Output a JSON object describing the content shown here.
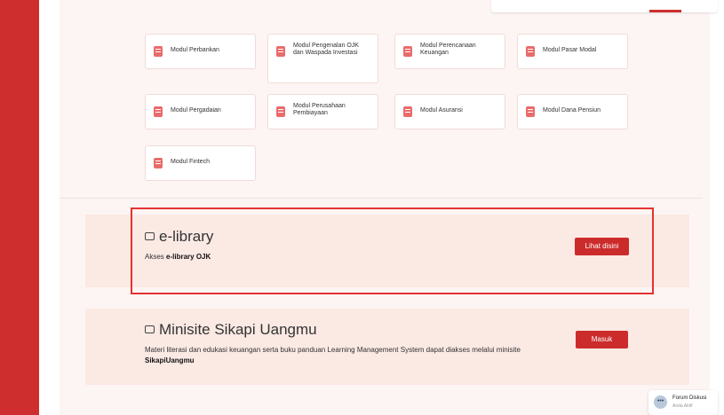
{
  "modules": [
    {
      "label": "Modul Perbankan"
    },
    {
      "label": "Modul Pengenalan OJK dan Waspada Investasi"
    },
    {
      "label": "Modul Perencanaan Keuangan"
    },
    {
      "label": "Modul Pasar Modal"
    },
    {
      "label": "Modul Pergadaian"
    },
    {
      "label": "Modul Perusahaan Pembiayaan"
    },
    {
      "label": "Modul Asuransi"
    },
    {
      "label": "Modul Dana Pensiun"
    },
    {
      "label": "Modul Fintech"
    }
  ],
  "elibrary": {
    "title": "e-library",
    "desc_prefix": "Akses",
    "desc_bold": "e-library OJK",
    "button": "Lihat disini"
  },
  "minisite": {
    "title": "Minisite Sikapi Uangmu",
    "desc_text": "Materi literasi dan edukasi keuangan serta buku panduan Learning Management System dapat diakses melalui minisite",
    "desc_bold": "SikapiUangmu",
    "button": "Masuk"
  },
  "forum": {
    "title": "Forum Diskusi",
    "subtitle": "Anda Aktif",
    "icon": "chat-bubble-icon"
  },
  "colors": {
    "brand_red": "#cc2b2b",
    "sidebar_red": "#cf2e2e",
    "panel_bg": "#fdf5f3",
    "section_bg": "#fbe9e4",
    "highlight": "#e53131"
  }
}
